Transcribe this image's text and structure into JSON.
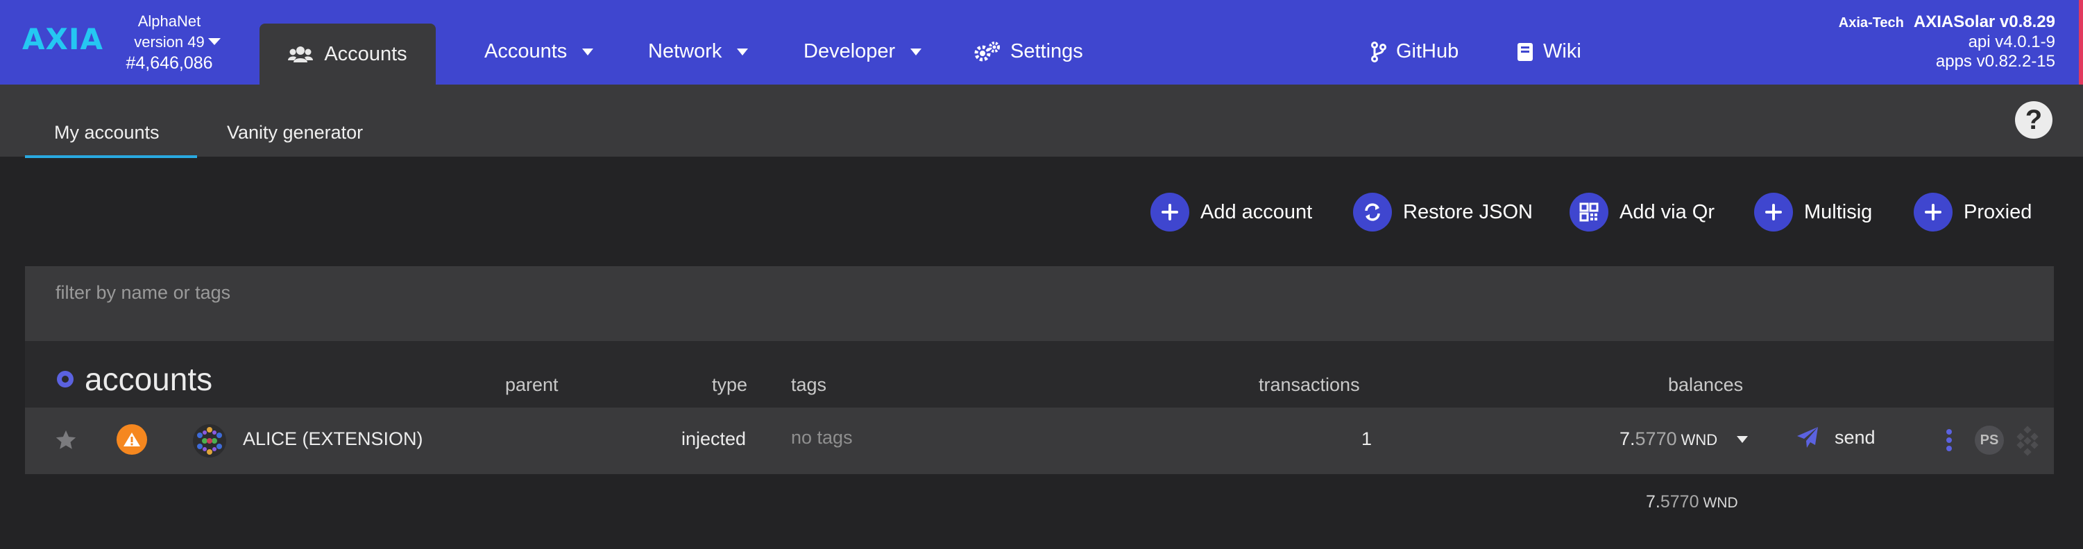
{
  "brand": {
    "logo": "AXIA",
    "accent": "#3f46cf",
    "logo_color": "#25c7f2"
  },
  "chain": {
    "name": "AlphaNet",
    "version": "version 49",
    "block": "#4,646,086"
  },
  "nav": {
    "active_tab": "Accounts",
    "items": [
      {
        "label": "Accounts",
        "has_dropdown": true
      },
      {
        "label": "Network",
        "has_dropdown": true
      },
      {
        "label": "Developer",
        "has_dropdown": true
      },
      {
        "label": "Settings",
        "has_dropdown": false
      }
    ],
    "github": "GitHub",
    "wiki": "Wiki"
  },
  "system": {
    "team": "Axia-Tech",
    "product": "AXIASolar v0.8.29",
    "api": "api v4.0.1-9",
    "apps": "apps v0.82.2-15"
  },
  "subtabs": [
    {
      "label": "My accounts",
      "active": true
    },
    {
      "label": "Vanity generator",
      "active": false
    }
  ],
  "help": "?",
  "actions": [
    {
      "label": "Add account",
      "icon": "plus-icon"
    },
    {
      "label": "Restore JSON",
      "icon": "sync-icon"
    },
    {
      "label": "Add via Qr",
      "icon": "qrcode-icon"
    },
    {
      "label": "Multisig",
      "icon": "plus-icon"
    },
    {
      "label": "Proxied",
      "icon": "plus-icon"
    }
  ],
  "filter": {
    "placeholder": "filter by name or tags",
    "value": ""
  },
  "table": {
    "title": "accounts",
    "headers": {
      "parent": "parent",
      "type": "type",
      "tags": "tags",
      "transactions": "transactions",
      "balances": "balances"
    },
    "rows": [
      {
        "name": "ALICE (EXTENSION)",
        "type": "injected",
        "tags": "no tags",
        "transactions": "1",
        "balance_int": "7.",
        "balance_dec": "5770",
        "balance_unit": "WND",
        "send": "send",
        "badge": "PS"
      }
    ],
    "total": {
      "int": "7.",
      "dec": "5770",
      "unit": "WND"
    }
  }
}
